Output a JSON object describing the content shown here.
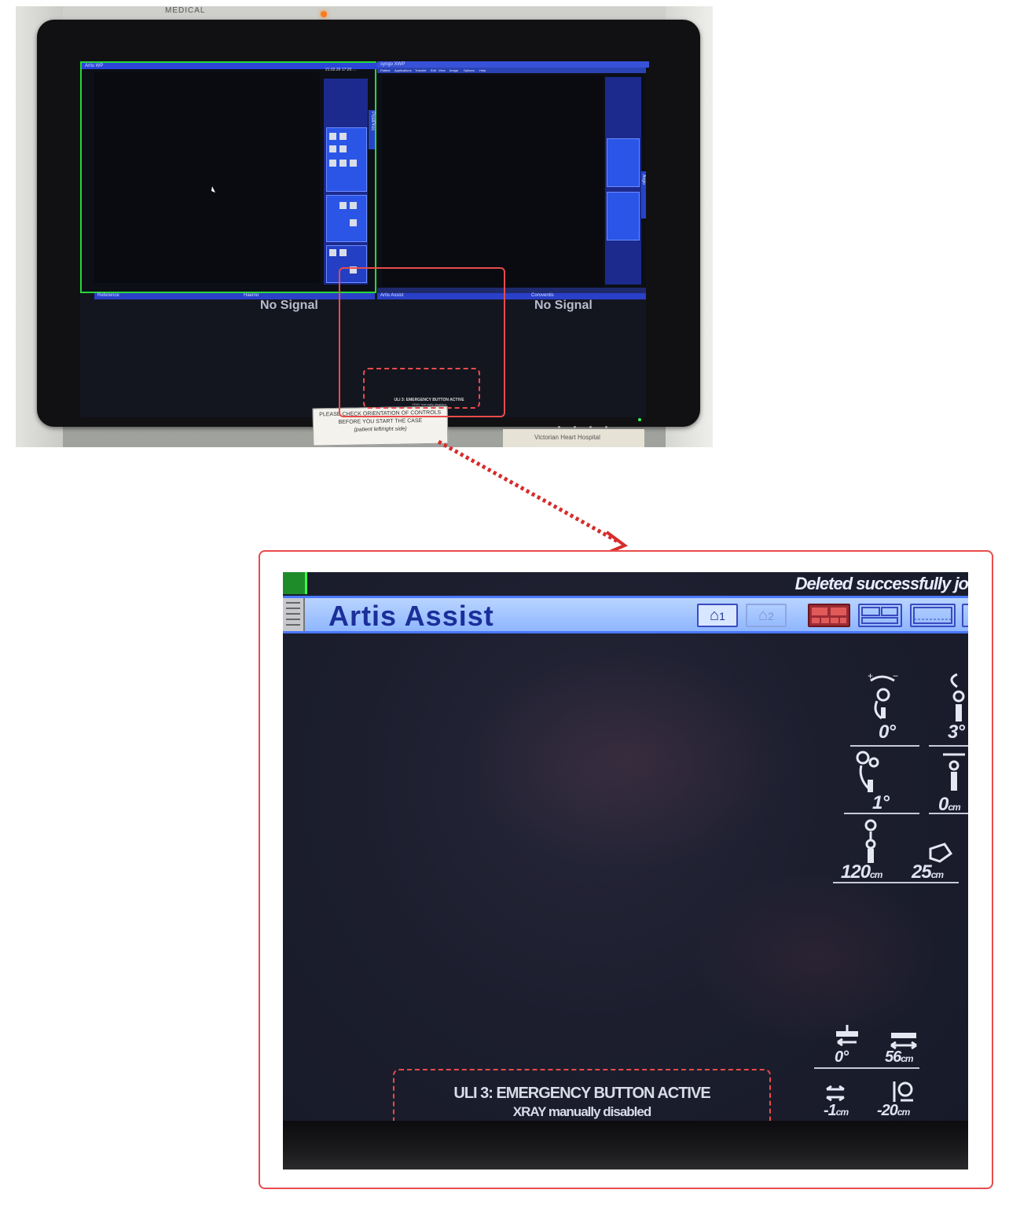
{
  "photo": {
    "medical_sign": "MEDICAL",
    "left_panel_title": "Artis WP",
    "left_date": "21.02.26 17:20 ...",
    "right_panel_title": "syngo XWP",
    "right_menu": [
      "Patient",
      "Applications",
      "Transfer",
      "Edit",
      "View",
      "Image",
      "Options",
      "Help"
    ],
    "postproc_label": "PostProc",
    "angio_label": "Angio",
    "bottom_left_tabs": [
      "Reference",
      "Haemo"
    ],
    "bottom_right_tabs": [
      "Artis Assist",
      "Coroventis"
    ],
    "no_signal_left": "No Signal",
    "no_signal_right": "No Signal",
    "mini_emergency_line1": "ULI 3: EMERGENCY BUTTON ACTIVE",
    "mini_emergency_line2": "XRAY manually disabled",
    "sticker": {
      "line1": "PLEASE CHECK ORIENTATION OF CONTROLS",
      "line2": "BEFORE YOU START THE CASE",
      "line3": "(patient left/right side)"
    },
    "book_text": "Victorian Heart Hospital"
  },
  "zoom": {
    "status_text": "Deleted successfully jo",
    "window_title": "Artis Assist",
    "home1_label": "1",
    "home2_label": "2",
    "readouts": {
      "rot1": "0°",
      "rot2": "3°",
      "tilt": "1°",
      "long": "0",
      "long_unit": "cm",
      "height": "120",
      "height_unit": "cm",
      "sid": "25",
      "sid_unit": "cm",
      "table_a": "0°",
      "table_b": "56",
      "table_b_unit": "cm",
      "table_c": "-1",
      "table_c_unit": "cm",
      "table_d": "-20",
      "table_d_unit": "cm"
    },
    "emergency_line1": "ULI 3: EMERGENCY BUTTON ACTIVE",
    "emergency_line2": "XRAY manually disabled"
  },
  "colors": {
    "highlight": "#e94b4b",
    "title_blue": "#1b2f9a",
    "active_green": "#28d63a"
  }
}
